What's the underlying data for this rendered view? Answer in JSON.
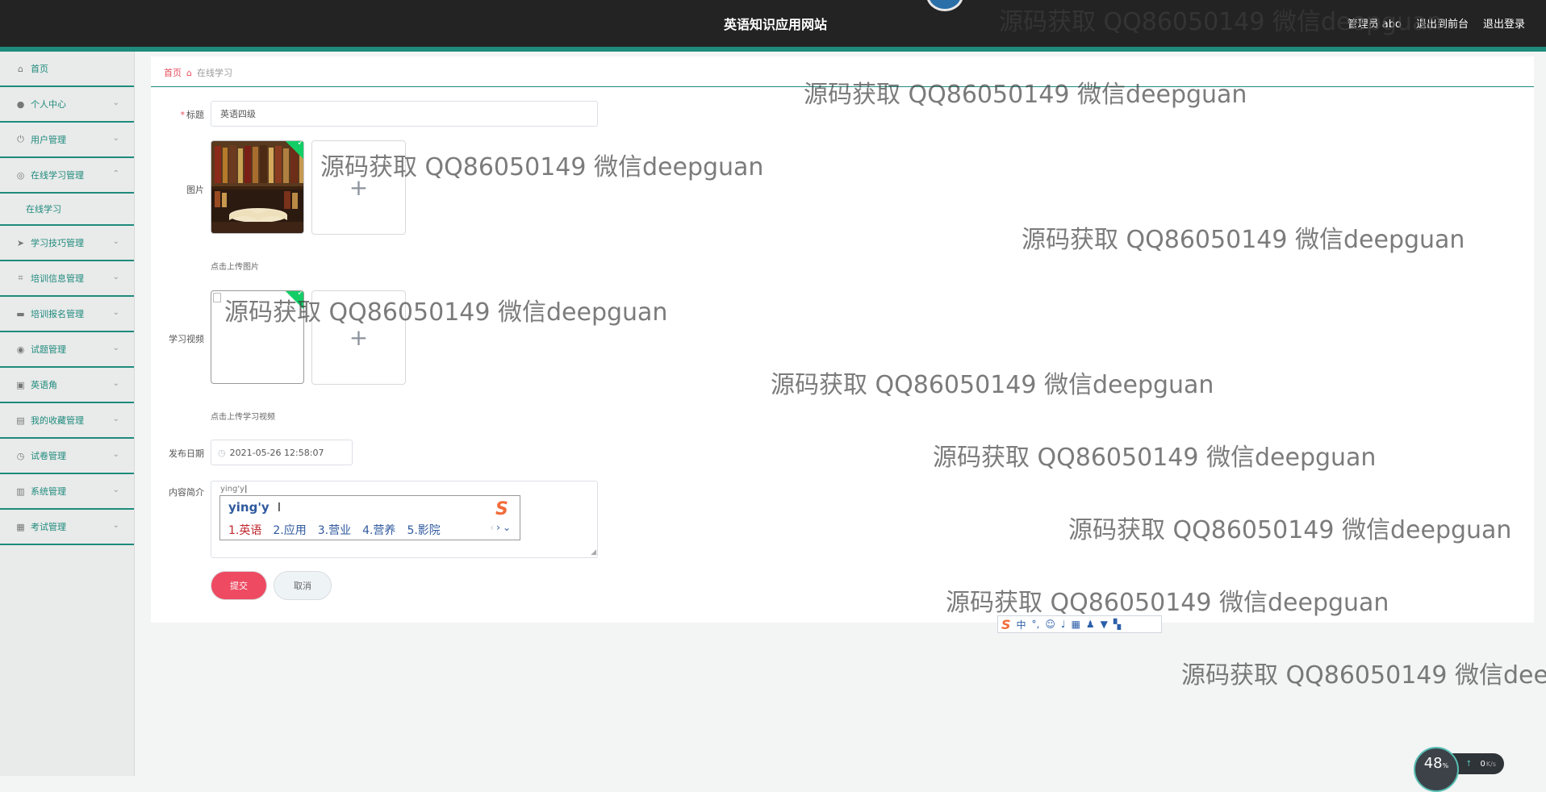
{
  "header": {
    "site_title": "英语知识应用网站",
    "user_label": "管理员 abo",
    "to_frontend": "退出到前台",
    "logout": "退出登录"
  },
  "sidebar": {
    "items": [
      {
        "label": "首页",
        "icon": "home-icon",
        "has_chevron": false
      },
      {
        "label": "个人中心",
        "icon": "user-icon",
        "has_chevron": true
      },
      {
        "label": "用户管理",
        "icon": "power-icon",
        "has_chevron": true
      },
      {
        "label": "在线学习管理",
        "icon": "dashboard-icon",
        "has_chevron": true,
        "expanded": true
      },
      {
        "label": "学习技巧管理",
        "icon": "send-icon",
        "has_chevron": true
      },
      {
        "label": "培训信息管理",
        "icon": "crop-icon",
        "has_chevron": true
      },
      {
        "label": "培训报名管理",
        "icon": "comment-icon",
        "has_chevron": true
      },
      {
        "label": "试题管理",
        "icon": "target-icon",
        "has_chevron": true
      },
      {
        "label": "英语角",
        "icon": "briefcase-icon",
        "has_chevron": true
      },
      {
        "label": "我的收藏管理",
        "icon": "book-icon",
        "has_chevron": true
      },
      {
        "label": "试卷管理",
        "icon": "clock-icon",
        "has_chevron": true
      },
      {
        "label": "系统管理",
        "icon": "clipboard-icon",
        "has_chevron": true
      },
      {
        "label": "考试管理",
        "icon": "checklist-icon",
        "has_chevron": true
      }
    ],
    "subitem": "在线学习"
  },
  "breadcrumb": {
    "home": "首页",
    "current": "在线学习"
  },
  "form": {
    "title_label": "标题",
    "title_value": "英语四级",
    "image_label": "图片",
    "image_hint": "点击上传图片",
    "video_label": "学习视频",
    "video_hint": "点击上传学习视频",
    "date_label": "发布日期",
    "date_value": "2021-05-26 12:58:07",
    "intro_label": "内容简介",
    "intro_value": "ying'y",
    "submit": "提交",
    "cancel": "取消",
    "broken_image_alt": "源码获取 QQ86050149 微信deepguan"
  },
  "ime": {
    "input": "ying'y",
    "candidates": [
      "1.英语",
      "2.应用",
      "3.营业",
      "4.营养",
      "5.影院"
    ],
    "toolbar_mode": "中"
  },
  "watermark_text": "源码获取 QQ86050149 微信deepguan",
  "net_widget": {
    "percent": "48",
    "percent_unit": "%",
    "speed": "0",
    "speed_unit": "K/s"
  }
}
